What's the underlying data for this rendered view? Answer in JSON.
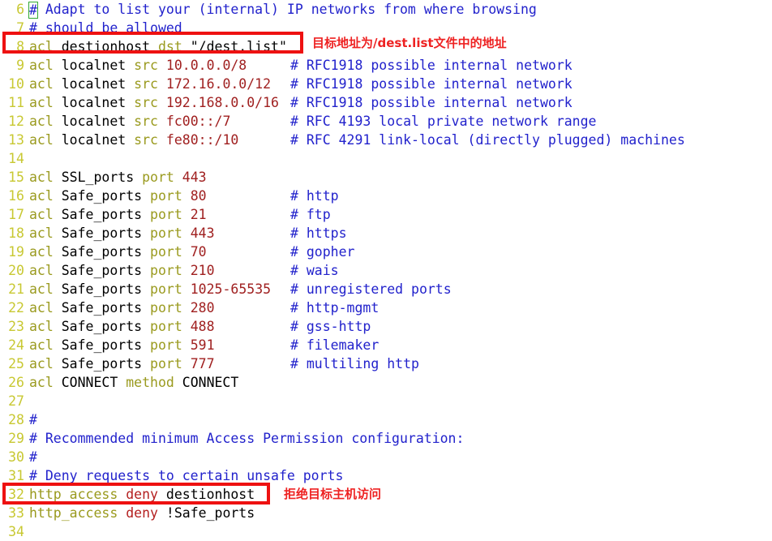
{
  "editor": {
    "title": "squid.conf",
    "colors": {
      "keyword": "#9a9a1e",
      "identifier": "#000000",
      "number": "#a02020",
      "comment": "#2222cc",
      "line_number": "#c8c832",
      "annotation": "#ee2222",
      "highlight_box": "#ee1111",
      "cursor_box": "#33aa33",
      "background": "#ffffff"
    }
  },
  "lines": [
    {
      "num": "6",
      "tokens": [
        {
          "text": "#",
          "cls": "cmt",
          "cursor": true
        },
        {
          "text": " Adapt to list your (internal) IP networks from where browsing",
          "cls": "cmt"
        }
      ]
    },
    {
      "num": "7",
      "tokens": [
        {
          "text": "# should be allowed",
          "cls": "cmt"
        }
      ]
    },
    {
      "num": "8",
      "tokens": [
        {
          "text": "acl",
          "cls": "kw"
        },
        {
          "text": " destionhost ",
          "cls": "ident"
        },
        {
          "text": "dst",
          "cls": "kw"
        },
        {
          "text": " \"/dest.list\"",
          "cls": "str"
        }
      ]
    },
    {
      "num": "9",
      "tokens": [
        {
          "text": "acl",
          "cls": "kw"
        },
        {
          "text": " localnet ",
          "cls": "ident"
        },
        {
          "text": "src",
          "cls": "kw"
        },
        {
          "text": " ",
          "cls": "plain"
        },
        {
          "text": "10.0.0.0/8",
          "cls": "num"
        }
      ],
      "comment": "# RFC1918 possible internal network"
    },
    {
      "num": "10",
      "tokens": [
        {
          "text": "acl",
          "cls": "kw"
        },
        {
          "text": " localnet ",
          "cls": "ident"
        },
        {
          "text": "src",
          "cls": "kw"
        },
        {
          "text": " ",
          "cls": "plain"
        },
        {
          "text": "172.16.0.0/12",
          "cls": "num"
        }
      ],
      "comment": "# RFC1918 possible internal network"
    },
    {
      "num": "11",
      "tokens": [
        {
          "text": "acl",
          "cls": "kw"
        },
        {
          "text": " localnet ",
          "cls": "ident"
        },
        {
          "text": "src",
          "cls": "kw"
        },
        {
          "text": " ",
          "cls": "plain"
        },
        {
          "text": "192.168.0.0/16",
          "cls": "num"
        }
      ],
      "comment": "# RFC1918 possible internal network"
    },
    {
      "num": "12",
      "tokens": [
        {
          "text": "acl",
          "cls": "kw"
        },
        {
          "text": " localnet ",
          "cls": "ident"
        },
        {
          "text": "src",
          "cls": "kw"
        },
        {
          "text": " ",
          "cls": "plain"
        },
        {
          "text": "fc00::/7",
          "cls": "num"
        }
      ],
      "comment": "# RFC 4193 local private network range"
    },
    {
      "num": "13",
      "tokens": [
        {
          "text": "acl",
          "cls": "kw"
        },
        {
          "text": " localnet ",
          "cls": "ident"
        },
        {
          "text": "src",
          "cls": "kw"
        },
        {
          "text": " ",
          "cls": "plain"
        },
        {
          "text": "fe80::/10",
          "cls": "num"
        }
      ],
      "comment": "# RFC 4291 link-local (directly plugged) machines"
    },
    {
      "num": "14",
      "tokens": []
    },
    {
      "num": "15",
      "tokens": [
        {
          "text": "acl",
          "cls": "kw"
        },
        {
          "text": " SSL_ports ",
          "cls": "ident"
        },
        {
          "text": "port",
          "cls": "kw"
        },
        {
          "text": " ",
          "cls": "plain"
        },
        {
          "text": "443",
          "cls": "num"
        }
      ]
    },
    {
      "num": "16",
      "tokens": [
        {
          "text": "acl",
          "cls": "kw"
        },
        {
          "text": " Safe_ports ",
          "cls": "ident"
        },
        {
          "text": "port",
          "cls": "kw"
        },
        {
          "text": " ",
          "cls": "plain"
        },
        {
          "text": "80",
          "cls": "num"
        }
      ],
      "comment": "# http"
    },
    {
      "num": "17",
      "tokens": [
        {
          "text": "acl",
          "cls": "kw"
        },
        {
          "text": " Safe_ports ",
          "cls": "ident"
        },
        {
          "text": "port",
          "cls": "kw"
        },
        {
          "text": " ",
          "cls": "plain"
        },
        {
          "text": "21",
          "cls": "num"
        }
      ],
      "comment": "# ftp"
    },
    {
      "num": "18",
      "tokens": [
        {
          "text": "acl",
          "cls": "kw"
        },
        {
          "text": " Safe_ports ",
          "cls": "ident"
        },
        {
          "text": "port",
          "cls": "kw"
        },
        {
          "text": " ",
          "cls": "plain"
        },
        {
          "text": "443",
          "cls": "num"
        }
      ],
      "comment": "# https"
    },
    {
      "num": "19",
      "tokens": [
        {
          "text": "acl",
          "cls": "kw"
        },
        {
          "text": " Safe_ports ",
          "cls": "ident"
        },
        {
          "text": "port",
          "cls": "kw"
        },
        {
          "text": " ",
          "cls": "plain"
        },
        {
          "text": "70",
          "cls": "num"
        }
      ],
      "comment": "# gopher"
    },
    {
      "num": "20",
      "tokens": [
        {
          "text": "acl",
          "cls": "kw"
        },
        {
          "text": " Safe_ports ",
          "cls": "ident"
        },
        {
          "text": "port",
          "cls": "kw"
        },
        {
          "text": " ",
          "cls": "plain"
        },
        {
          "text": "210",
          "cls": "num"
        }
      ],
      "comment": "# wais"
    },
    {
      "num": "21",
      "tokens": [
        {
          "text": "acl",
          "cls": "kw"
        },
        {
          "text": " Safe_ports ",
          "cls": "ident"
        },
        {
          "text": "port",
          "cls": "kw"
        },
        {
          "text": " ",
          "cls": "plain"
        },
        {
          "text": "1025-65535",
          "cls": "num"
        }
      ],
      "comment": "# unregistered ports"
    },
    {
      "num": "22",
      "tokens": [
        {
          "text": "acl",
          "cls": "kw"
        },
        {
          "text": " Safe_ports ",
          "cls": "ident"
        },
        {
          "text": "port",
          "cls": "kw"
        },
        {
          "text": " ",
          "cls": "plain"
        },
        {
          "text": "280",
          "cls": "num"
        }
      ],
      "comment": "# http-mgmt"
    },
    {
      "num": "23",
      "tokens": [
        {
          "text": "acl",
          "cls": "kw"
        },
        {
          "text": " Safe_ports ",
          "cls": "ident"
        },
        {
          "text": "port",
          "cls": "kw"
        },
        {
          "text": " ",
          "cls": "plain"
        },
        {
          "text": "488",
          "cls": "num"
        }
      ],
      "comment": "# gss-http"
    },
    {
      "num": "24",
      "tokens": [
        {
          "text": "acl",
          "cls": "kw"
        },
        {
          "text": " Safe_ports ",
          "cls": "ident"
        },
        {
          "text": "port",
          "cls": "kw"
        },
        {
          "text": " ",
          "cls": "plain"
        },
        {
          "text": "591",
          "cls": "num"
        }
      ],
      "comment": "# filemaker"
    },
    {
      "num": "25",
      "tokens": [
        {
          "text": "acl",
          "cls": "kw"
        },
        {
          "text": " Safe_ports ",
          "cls": "ident"
        },
        {
          "text": "port",
          "cls": "kw"
        },
        {
          "text": " ",
          "cls": "plain"
        },
        {
          "text": "777",
          "cls": "num"
        }
      ],
      "comment": "# multiling http"
    },
    {
      "num": "26",
      "tokens": [
        {
          "text": "acl",
          "cls": "kw"
        },
        {
          "text": " CONNECT ",
          "cls": "ident"
        },
        {
          "text": "method",
          "cls": "kw"
        },
        {
          "text": " CONNECT",
          "cls": "ident"
        }
      ]
    },
    {
      "num": "27",
      "tokens": []
    },
    {
      "num": "28",
      "tokens": [
        {
          "text": "#",
          "cls": "cmt"
        }
      ]
    },
    {
      "num": "29",
      "tokens": [
        {
          "text": "# Recommended minimum Access Permission configuration:",
          "cls": "cmt"
        }
      ]
    },
    {
      "num": "30",
      "tokens": [
        {
          "text": "#",
          "cls": "cmt"
        }
      ]
    },
    {
      "num": "31",
      "tokens": [
        {
          "text": "# Deny requests to certain unsafe ports",
          "cls": "cmt"
        }
      ]
    },
    {
      "num": "32",
      "tokens": [
        {
          "text": "http_access",
          "cls": "kw"
        },
        {
          "text": " ",
          "cls": "plain"
        },
        {
          "text": "deny",
          "cls": "deny"
        },
        {
          "text": " destionhost",
          "cls": "ident"
        }
      ]
    },
    {
      "num": "33",
      "tokens": [
        {
          "text": "http_access",
          "cls": "kw"
        },
        {
          "text": " ",
          "cls": "plain"
        },
        {
          "text": "deny",
          "cls": "deny"
        },
        {
          "text": " !Safe_ports",
          "cls": "ident"
        }
      ]
    },
    {
      "num": "34",
      "tokens": []
    }
  ],
  "annotations": {
    "dest_list": "目标地址为/dest.list文件中的地址",
    "deny_host": "拒绝目标主机访问"
  }
}
